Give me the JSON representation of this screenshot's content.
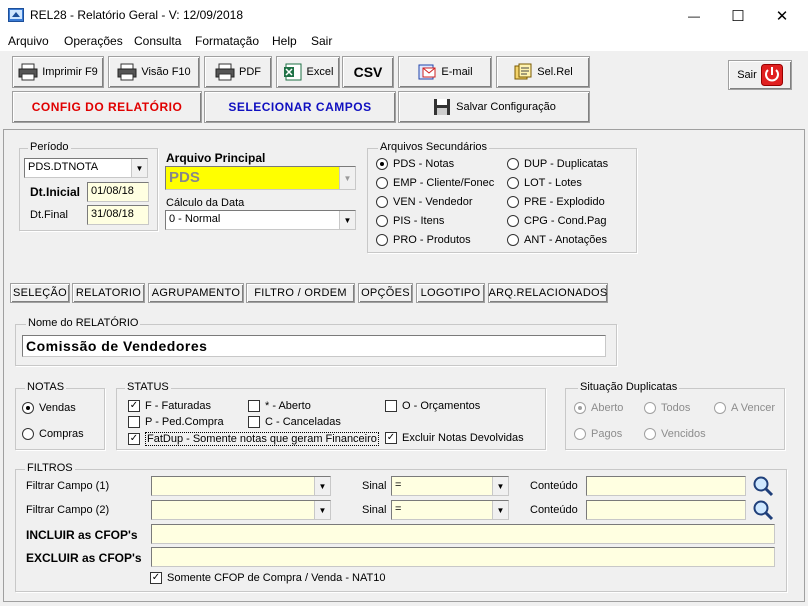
{
  "window": {
    "title": "REL28 - Relatório Geral - V: 12/09/2018",
    "minimize": "—",
    "maximize": "☐",
    "close": "✕"
  },
  "menu": [
    "Arquivo",
    "Operações",
    "Consulta",
    "Formatação",
    "Help",
    "Sair"
  ],
  "toolbar": {
    "print": "Imprimir F9",
    "preview": "Visão F10",
    "pdf": "PDF",
    "excel": "Excel",
    "csv": "CSV",
    "email": "E-mail",
    "selrel": "Sel.Rel",
    "exit": "Sair",
    "config": "CONFIG  DO  RELATÓRIO",
    "select_fields": "SELECIONAR  CAMPOS",
    "save_config": "Salvar Configuração"
  },
  "colors": {
    "config_text": "#e00000",
    "select_text": "#1010c0",
    "principal_bg": "#ffff00"
  },
  "periodo": {
    "legend": "Período",
    "field": "PDS.DTNOTA",
    "dt_inicial_label": "Dt.Inicial",
    "dt_inicial": "01/08/18",
    "dt_final_label": "Dt.Final",
    "dt_final": "31/08/18"
  },
  "principal": {
    "label": "Arquivo Principal",
    "value": "PDS",
    "calc_label": "Cálculo da Data",
    "calc_value": "0 - Normal"
  },
  "secundarios": {
    "legend": "Arquivos Secundários",
    "col1": [
      "PDS - Notas",
      "EMP - Cliente/Fonec",
      "VEN - Vendedor",
      "PIS - Itens",
      "PRO - Produtos"
    ],
    "col2": [
      "DUP - Duplicatas",
      "LOT - Lotes",
      "PRE - Explodido",
      "CPG - Cond.Pag",
      "ANT - Anotações"
    ]
  },
  "tabs": [
    "SELEÇÃO",
    "RELATORIO",
    "AGRUPAMENTO",
    "FILTRO / ORDEM",
    "OPÇÕES",
    "LOGOTIPO",
    "ARQ.RELACIONADOS"
  ],
  "nome": {
    "legend": "Nome do RELATÓRIO",
    "value": "Comissão de Vendedores"
  },
  "notas": {
    "legend": "NOTAS",
    "vendas": "Vendas",
    "compras": "Compras"
  },
  "status": {
    "legend": "STATUS",
    "faturadas": "F - Faturadas",
    "ped_compra": "P - Ped.Compra",
    "aberto": "* - Aberto",
    "canceladas": "C - Canceladas",
    "orcamentos": "O - Orçamentos",
    "fatdup": "FatDup - Somente notas que geram Financeiro",
    "excluir_dev": "Excluir Notas Devolvidas"
  },
  "situacao": {
    "legend": "Situação Duplicatas",
    "aberto": "Aberto",
    "todos": "Todos",
    "avencer": "A Vencer",
    "pagos": "Pagos",
    "vencidos": "Vencidos"
  },
  "filtros": {
    "legend": "FILTROS",
    "campo1": "Filtrar Campo (1)",
    "campo2": "Filtrar Campo (2)",
    "sinal": "Sinal",
    "sinal_value": "=",
    "conteudo": "Conteúdo",
    "incluir": "INCLUIR as CFOP's",
    "excluir": "EXCLUIR as CFOP's",
    "somente": "Somente CFOP de  Compra / Venda - NAT10"
  },
  "check_mark": "✓",
  "combo_arrow": "▼"
}
